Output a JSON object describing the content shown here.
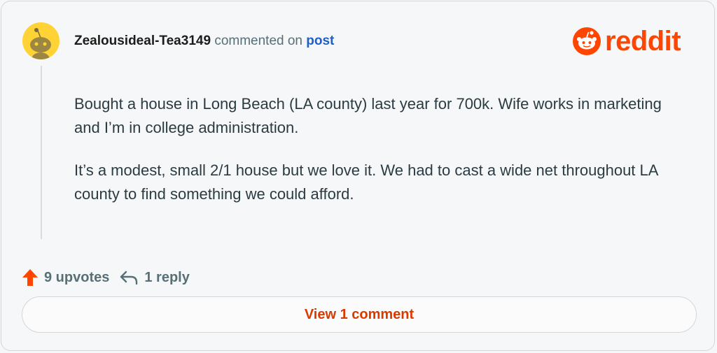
{
  "comment": {
    "username": "Zealousideal-Tea3149",
    "action_text": "commented on",
    "post_link_label": "post",
    "paragraphs": [
      "Bought a house in Long Beach (LA county) last year for 700k. Wife works in marketing and I’m in college administration.",
      "It’s a modest, small 2/1 house but we love it. We had to cast a wide net throughout LA county to find something we could afford."
    ]
  },
  "brand": {
    "logo_text": "reddit",
    "color": "#ff4500",
    "avatar_color": "#ffd235"
  },
  "footer": {
    "upvotes_label": "9 upvotes",
    "replies_label": "1 reply",
    "upvote_icon": "upvote-arrow-icon",
    "reply_icon": "reply-arrow-icon"
  },
  "view_button": {
    "label": "View 1 comment"
  }
}
